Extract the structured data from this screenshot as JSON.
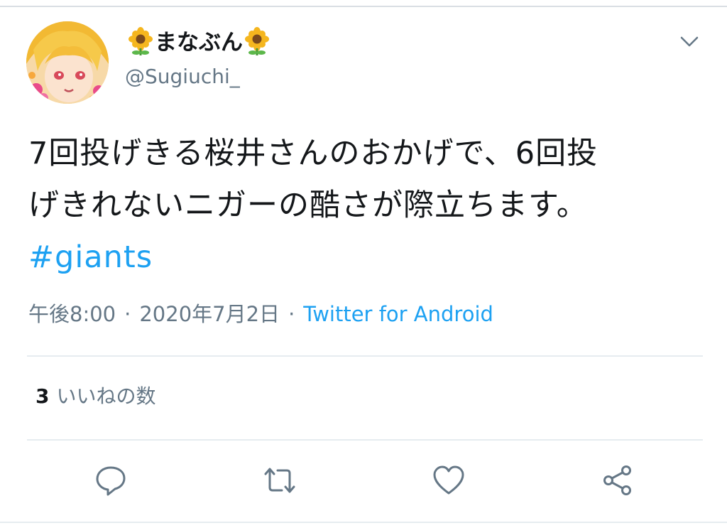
{
  "author": {
    "display_name": "まなぶん",
    "handle": "@Sugiuchi_",
    "name_emoji": "sunflower-icon"
  },
  "tweet": {
    "line1": "7回投げきる桜井さんのおかげで、6回投",
    "line2": "げきれないニガーの酷さが際立ちます。",
    "hashtag": "#giants"
  },
  "meta": {
    "time": "午後8:00",
    "separator": "·",
    "date": "2020年7月2日",
    "client": "Twitter for Android"
  },
  "stats": {
    "likes_count": "3",
    "likes_label": "いいねの数"
  },
  "actions": [
    "reply-icon",
    "retweet-icon",
    "like-icon",
    "share-icon"
  ],
  "colors": {
    "accent": "#1da1f2",
    "text": "#14171a",
    "secondary": "#657786",
    "divider": "#e6ecf0",
    "icon": "#657786"
  }
}
